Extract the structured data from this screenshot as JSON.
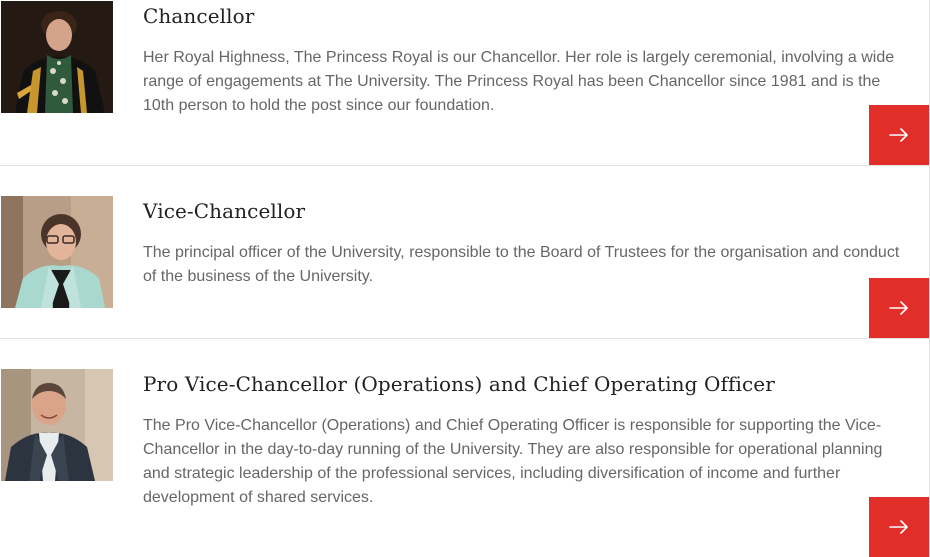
{
  "roles": [
    {
      "title": "Chancellor",
      "description": "Her Royal Highness, The Princess Royal is our Chancellor. Her role is largely ceremonial, involving a wide range of engagements at The University. The Princess Royal has been Chancellor since 1981 and is the 10th person to hold the post since our foundation.",
      "photo": "chancellor-portrait",
      "link_icon": "arrow-right-icon"
    },
    {
      "title": "Vice-Chancellor",
      "description": "The principal officer of the University, responsible to the Board of Trustees for the organisation and conduct of the business of the University.",
      "photo": "vice-chancellor-portrait",
      "link_icon": "arrow-right-icon"
    },
    {
      "title": "Pro Vice-Chancellor (Operations) and Chief Operating Officer",
      "description": "The Pro Vice-Chancellor (Operations) and Chief Operating Officer is responsible for supporting the Vice-Chancellor in the day-to-day running of the University. They are also responsible for operational planning and strategic leadership of the professional services, including diversification of income and further development of shared services.",
      "photo": "pro-vice-chancellor-portrait",
      "link_icon": "arrow-right-icon"
    }
  ],
  "colors": {
    "accent": "#e12e29",
    "title_text": "#222222",
    "body_text": "#666666",
    "divider": "#e3e3e3"
  }
}
